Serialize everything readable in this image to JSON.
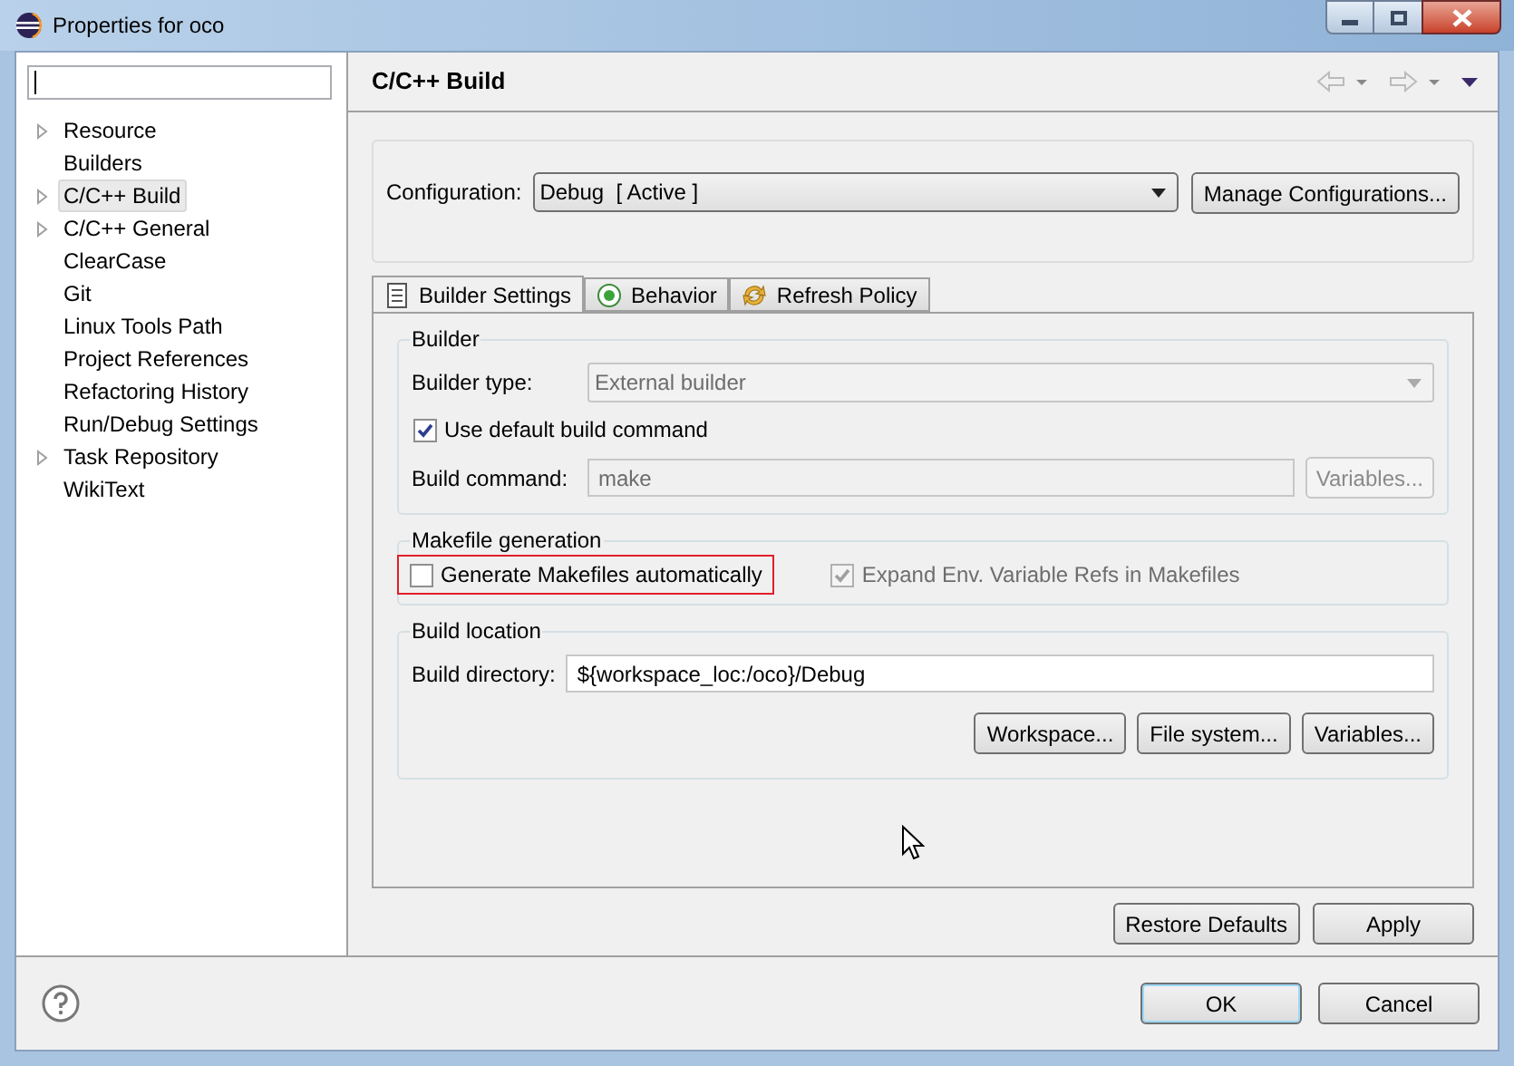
{
  "window": {
    "title": "Properties for oco"
  },
  "tree": [
    {
      "label": "Resource",
      "expandable": true,
      "selected": false
    },
    {
      "label": "Builders",
      "expandable": false,
      "selected": false
    },
    {
      "label": "C/C++ Build",
      "expandable": true,
      "selected": true
    },
    {
      "label": "C/C++ General",
      "expandable": true,
      "selected": false
    },
    {
      "label": "ClearCase",
      "expandable": false,
      "selected": false
    },
    {
      "label": "Git",
      "expandable": false,
      "selected": false
    },
    {
      "label": "Linux Tools Path",
      "expandable": false,
      "selected": false
    },
    {
      "label": "Project References",
      "expandable": false,
      "selected": false
    },
    {
      "label": "Refactoring History",
      "expandable": false,
      "selected": false
    },
    {
      "label": "Run/Debug Settings",
      "expandable": false,
      "selected": false
    },
    {
      "label": "Task Repository",
      "expandable": true,
      "selected": false
    },
    {
      "label": "WikiText",
      "expandable": false,
      "selected": false
    }
  ],
  "page": {
    "title": "C/C++ Build"
  },
  "configuration": {
    "label": "Configuration:",
    "value": "Debug  [ Active ]",
    "button": "Manage Configurations..."
  },
  "tabs": [
    {
      "label": "Builder Settings",
      "kind": "list",
      "selected": true
    },
    {
      "label": "Behavior",
      "kind": "radio",
      "selected": false
    },
    {
      "label": "Refresh Policy",
      "kind": "refresh",
      "selected": false
    }
  ],
  "builder": {
    "title": "Builder",
    "type_label": "Builder type:",
    "type_value": "External builder",
    "use_default": {
      "label": "Use default build command",
      "checked": true,
      "disabled": false
    },
    "command_label": "Build command:",
    "command_value": "make",
    "variables": "Variables..."
  },
  "makefile": {
    "title": "Makefile generation",
    "options": [
      {
        "label": "Generate Makefiles automatically",
        "checked": false,
        "disabled": false,
        "highlighted": true
      },
      {
        "label": "Expand Env. Variable Refs in Makefiles",
        "checked": true,
        "disabled": true,
        "highlighted": false
      }
    ]
  },
  "location": {
    "title": "Build location",
    "dir_label": "Build directory:",
    "dir_value": "${workspace_loc:/oco}/Debug",
    "buttons": [
      "Workspace...",
      "File system...",
      "Variables..."
    ]
  },
  "page_buttons": [
    "Restore Defaults",
    "Apply"
  ],
  "dialog_buttons": [
    {
      "label": "OK",
      "default": true
    },
    {
      "label": "Cancel",
      "default": false
    }
  ]
}
